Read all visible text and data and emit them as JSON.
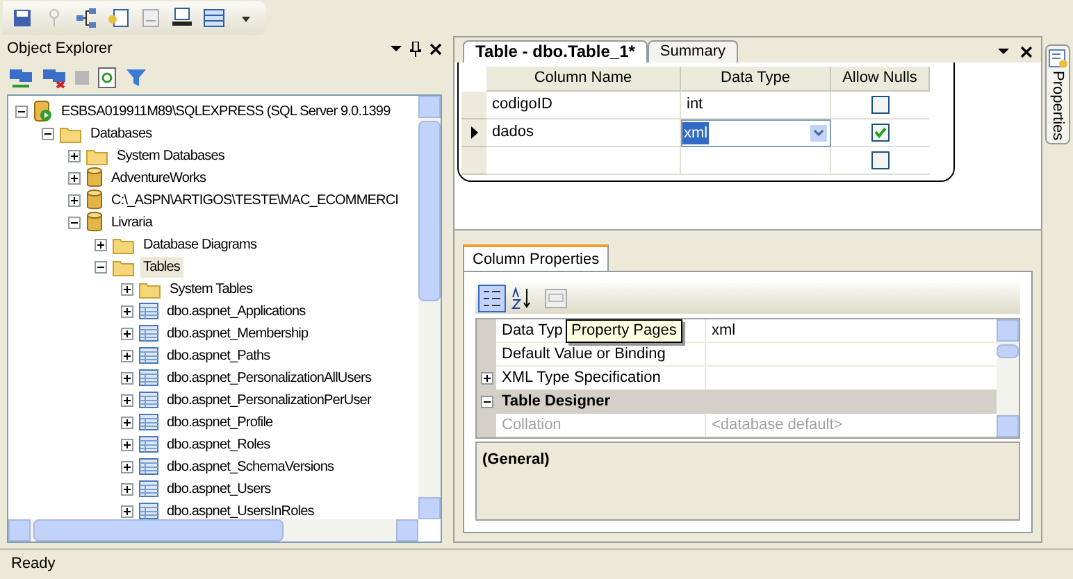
{
  "object_explorer": {
    "title": "Object Explorer",
    "tree": [
      {
        "label": "ESBSA019911M89\\SQLEXPRESS (SQL Server 9.0.1399",
        "kind": "server",
        "expanded": true,
        "selected": false,
        "children": [
          {
            "label": "Databases",
            "kind": "folder",
            "expanded": true,
            "selected": false,
            "children": [
              {
                "label": "System Databases",
                "kind": "folder",
                "expanded": false,
                "selected": false
              },
              {
                "label": "AdventureWorks",
                "kind": "database",
                "expanded": false,
                "selected": false
              },
              {
                "label": "C:\\_ASPN\\ARTIGOS\\TESTE\\MAC_ECOMMERCI",
                "kind": "database",
                "expanded": false,
                "selected": false
              },
              {
                "label": "Livraria",
                "kind": "database",
                "expanded": true,
                "selected": false,
                "children": [
                  {
                    "label": "Database Diagrams",
                    "kind": "folder",
                    "expanded": false,
                    "selected": false
                  },
                  {
                    "label": "Tables",
                    "kind": "folder",
                    "expanded": true,
                    "selected": true,
                    "children": [
                      {
                        "label": "System Tables",
                        "kind": "folder",
                        "expanded": false,
                        "selected": false
                      },
                      {
                        "label": "dbo.aspnet_Applications",
                        "kind": "table",
                        "expanded": false,
                        "selected": false
                      },
                      {
                        "label": "dbo.aspnet_Membership",
                        "kind": "table",
                        "expanded": false,
                        "selected": false
                      },
                      {
                        "label": "dbo.aspnet_Paths",
                        "kind": "table",
                        "expanded": false,
                        "selected": false
                      },
                      {
                        "label": "dbo.aspnet_PersonalizationAllUsers",
                        "kind": "table",
                        "expanded": false,
                        "selected": false
                      },
                      {
                        "label": "dbo.aspnet_PersonalizationPerUser",
                        "kind": "table",
                        "expanded": false,
                        "selected": false
                      },
                      {
                        "label": "dbo.aspnet_Profile",
                        "kind": "table",
                        "expanded": false,
                        "selected": false
                      },
                      {
                        "label": "dbo.aspnet_Roles",
                        "kind": "table",
                        "expanded": false,
                        "selected": false
                      },
                      {
                        "label": "dbo.aspnet_SchemaVersions",
                        "kind": "table",
                        "expanded": false,
                        "selected": false
                      },
                      {
                        "label": "dbo.aspnet_Users",
                        "kind": "table",
                        "expanded": false,
                        "selected": false
                      },
                      {
                        "label": "dbo.aspnet_UsersInRoles",
                        "kind": "table",
                        "expanded": false,
                        "selected": false
                      }
                    ]
                  }
                ]
              }
            ]
          }
        ]
      }
    ]
  },
  "designer": {
    "tabs": [
      {
        "label": "Table - dbo.Table_1*",
        "selected": true
      },
      {
        "label": "Summary",
        "selected": false
      }
    ],
    "columns": [
      "Column Name",
      "Data Type",
      "Allow Nulls"
    ],
    "rows": [
      {
        "name": "codigoID",
        "type": "int",
        "allow_nulls": false,
        "current": false
      },
      {
        "name": "dados",
        "type": "xml",
        "allow_nulls": true,
        "current": true
      },
      {
        "allow_nulls": false,
        "current": false
      }
    ]
  },
  "column_properties": {
    "tab": "Column Properties",
    "tooltip": "Property Pages",
    "properties": [
      {
        "kind": "property",
        "name": "Data Typ",
        "value": "xml",
        "disabled": false
      },
      {
        "kind": "property",
        "name": "Default Value or Binding",
        "disabled": false
      },
      {
        "kind": "property",
        "name": "XML Type Specification",
        "expanded": false,
        "disabled": false
      },
      {
        "kind": "category",
        "name": "Table Designer",
        "expanded": true
      },
      {
        "kind": "property",
        "name": "Collation",
        "value": "<database default>",
        "disabled": true
      }
    ],
    "description": "(General)"
  },
  "side_tab": "Properties",
  "status_bar": "Ready"
}
